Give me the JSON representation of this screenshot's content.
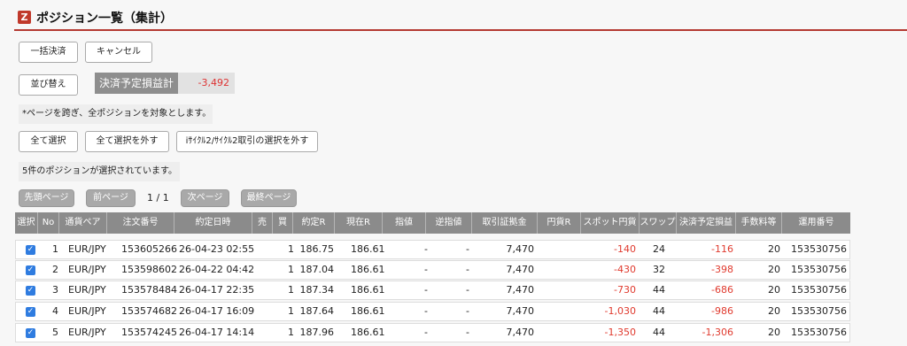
{
  "header": {
    "logo": "Z",
    "title": "ポジション一覧（集計）"
  },
  "buttons": {
    "bulk_settle": "一括決済",
    "cancel": "キャンセル",
    "sort": "並び替え",
    "select_all": "全て選択",
    "deselect_all": "全て選択を外す",
    "deselect_cycle": "iｻｲｸﾙ2/ｻｲｸﾙ2取引の選択を外す"
  },
  "summary": {
    "label": "決済予定損益計",
    "value": "-3,492"
  },
  "notice": "*ページを跨ぎ、全ポジションを対象とします。",
  "selected_message": "5件のポジションが選択されています。",
  "pager": {
    "first": "先頭ページ",
    "prev": "前ページ",
    "page": "1 / 1",
    "next": "次ページ",
    "last": "最終ページ"
  },
  "table": {
    "headers": [
      "選択",
      "No",
      "通貨ペア",
      "注文番号",
      "約定日時",
      "売",
      "買",
      "約定R",
      "現在R",
      "指値",
      "逆指値",
      "取引証拠金",
      "円貨R",
      "スポット円貨",
      "スワップ",
      "決済予定損益",
      "手数料等",
      "運用番号"
    ],
    "rows": [
      {
        "no": "1",
        "pair": "EUR/JPY",
        "order_no": "153605266",
        "datetime": "26-04-23 02:55",
        "sell": "",
        "buy": "1",
        "exec_rate": "186.75",
        "current_rate": "186.61",
        "limit": "-",
        "stop": "-",
        "margin": "7,470",
        "jpy_rate": "",
        "spot_jpy": "-140",
        "swap": "24",
        "pl": "-116",
        "fee": "20",
        "op_no": "153530756"
      },
      {
        "no": "2",
        "pair": "EUR/JPY",
        "order_no": "153598602",
        "datetime": "26-04-22 04:42",
        "sell": "",
        "buy": "1",
        "exec_rate": "187.04",
        "current_rate": "186.61",
        "limit": "-",
        "stop": "-",
        "margin": "7,470",
        "jpy_rate": "",
        "spot_jpy": "-430",
        "swap": "32",
        "pl": "-398",
        "fee": "20",
        "op_no": "153530756"
      },
      {
        "no": "3",
        "pair": "EUR/JPY",
        "order_no": "153578484",
        "datetime": "26-04-17 22:35",
        "sell": "",
        "buy": "1",
        "exec_rate": "187.34",
        "current_rate": "186.61",
        "limit": "-",
        "stop": "-",
        "margin": "7,470",
        "jpy_rate": "",
        "spot_jpy": "-730",
        "swap": "44",
        "pl": "-686",
        "fee": "20",
        "op_no": "153530756"
      },
      {
        "no": "4",
        "pair": "EUR/JPY",
        "order_no": "153574682",
        "datetime": "26-04-17 16:09",
        "sell": "",
        "buy": "1",
        "exec_rate": "187.64",
        "current_rate": "186.61",
        "limit": "-",
        "stop": "-",
        "margin": "7,470",
        "jpy_rate": "",
        "spot_jpy": "-1,030",
        "swap": "44",
        "pl": "-986",
        "fee": "20",
        "op_no": "153530756"
      },
      {
        "no": "5",
        "pair": "EUR/JPY",
        "order_no": "153574245",
        "datetime": "26-04-17 14:14",
        "sell": "",
        "buy": "1",
        "exec_rate": "187.96",
        "current_rate": "186.61",
        "limit": "-",
        "stop": "-",
        "margin": "7,470",
        "jpy_rate": "",
        "spot_jpy": "-1,350",
        "swap": "44",
        "pl": "-1,306",
        "fee": "20",
        "op_no": "153530756"
      }
    ]
  },
  "colors": {
    "accent": "#b43a32",
    "negative": "#e03a2e",
    "checkbox": "#2f7ce0",
    "header_bg": "#8b8b8b"
  },
  "icons": {
    "logo": "z-logo-icon",
    "checkbox": "checkbox-checked-icon"
  }
}
